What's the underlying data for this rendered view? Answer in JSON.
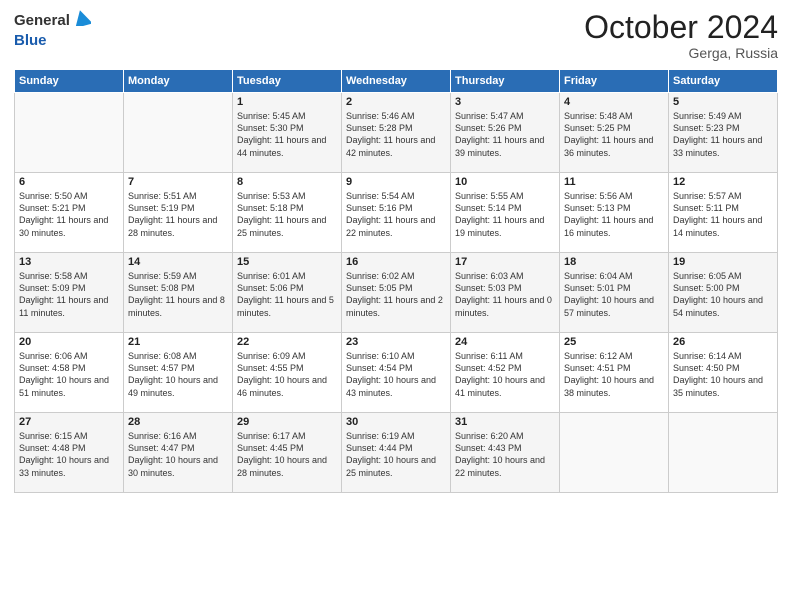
{
  "header": {
    "logo_general": "General",
    "logo_blue": "Blue",
    "month_year": "October 2024",
    "location": "Gerga, Russia"
  },
  "columns": [
    "Sunday",
    "Monday",
    "Tuesday",
    "Wednesday",
    "Thursday",
    "Friday",
    "Saturday"
  ],
  "weeks": [
    [
      {
        "day": "",
        "info": ""
      },
      {
        "day": "",
        "info": ""
      },
      {
        "day": "1",
        "info": "Sunrise: 5:45 AM\nSunset: 5:30 PM\nDaylight: 11 hours and 44 minutes."
      },
      {
        "day": "2",
        "info": "Sunrise: 5:46 AM\nSunset: 5:28 PM\nDaylight: 11 hours and 42 minutes."
      },
      {
        "day": "3",
        "info": "Sunrise: 5:47 AM\nSunset: 5:26 PM\nDaylight: 11 hours and 39 minutes."
      },
      {
        "day": "4",
        "info": "Sunrise: 5:48 AM\nSunset: 5:25 PM\nDaylight: 11 hours and 36 minutes."
      },
      {
        "day": "5",
        "info": "Sunrise: 5:49 AM\nSunset: 5:23 PM\nDaylight: 11 hours and 33 minutes."
      }
    ],
    [
      {
        "day": "6",
        "info": "Sunrise: 5:50 AM\nSunset: 5:21 PM\nDaylight: 11 hours and 30 minutes."
      },
      {
        "day": "7",
        "info": "Sunrise: 5:51 AM\nSunset: 5:19 PM\nDaylight: 11 hours and 28 minutes."
      },
      {
        "day": "8",
        "info": "Sunrise: 5:53 AM\nSunset: 5:18 PM\nDaylight: 11 hours and 25 minutes."
      },
      {
        "day": "9",
        "info": "Sunrise: 5:54 AM\nSunset: 5:16 PM\nDaylight: 11 hours and 22 minutes."
      },
      {
        "day": "10",
        "info": "Sunrise: 5:55 AM\nSunset: 5:14 PM\nDaylight: 11 hours and 19 minutes."
      },
      {
        "day": "11",
        "info": "Sunrise: 5:56 AM\nSunset: 5:13 PM\nDaylight: 11 hours and 16 minutes."
      },
      {
        "day": "12",
        "info": "Sunrise: 5:57 AM\nSunset: 5:11 PM\nDaylight: 11 hours and 14 minutes."
      }
    ],
    [
      {
        "day": "13",
        "info": "Sunrise: 5:58 AM\nSunset: 5:09 PM\nDaylight: 11 hours and 11 minutes."
      },
      {
        "day": "14",
        "info": "Sunrise: 5:59 AM\nSunset: 5:08 PM\nDaylight: 11 hours and 8 minutes."
      },
      {
        "day": "15",
        "info": "Sunrise: 6:01 AM\nSunset: 5:06 PM\nDaylight: 11 hours and 5 minutes."
      },
      {
        "day": "16",
        "info": "Sunrise: 6:02 AM\nSunset: 5:05 PM\nDaylight: 11 hours and 2 minutes."
      },
      {
        "day": "17",
        "info": "Sunrise: 6:03 AM\nSunset: 5:03 PM\nDaylight: 11 hours and 0 minutes."
      },
      {
        "day": "18",
        "info": "Sunrise: 6:04 AM\nSunset: 5:01 PM\nDaylight: 10 hours and 57 minutes."
      },
      {
        "day": "19",
        "info": "Sunrise: 6:05 AM\nSunset: 5:00 PM\nDaylight: 10 hours and 54 minutes."
      }
    ],
    [
      {
        "day": "20",
        "info": "Sunrise: 6:06 AM\nSunset: 4:58 PM\nDaylight: 10 hours and 51 minutes."
      },
      {
        "day": "21",
        "info": "Sunrise: 6:08 AM\nSunset: 4:57 PM\nDaylight: 10 hours and 49 minutes."
      },
      {
        "day": "22",
        "info": "Sunrise: 6:09 AM\nSunset: 4:55 PM\nDaylight: 10 hours and 46 minutes."
      },
      {
        "day": "23",
        "info": "Sunrise: 6:10 AM\nSunset: 4:54 PM\nDaylight: 10 hours and 43 minutes."
      },
      {
        "day": "24",
        "info": "Sunrise: 6:11 AM\nSunset: 4:52 PM\nDaylight: 10 hours and 41 minutes."
      },
      {
        "day": "25",
        "info": "Sunrise: 6:12 AM\nSunset: 4:51 PM\nDaylight: 10 hours and 38 minutes."
      },
      {
        "day": "26",
        "info": "Sunrise: 6:14 AM\nSunset: 4:50 PM\nDaylight: 10 hours and 35 minutes."
      }
    ],
    [
      {
        "day": "27",
        "info": "Sunrise: 6:15 AM\nSunset: 4:48 PM\nDaylight: 10 hours and 33 minutes."
      },
      {
        "day": "28",
        "info": "Sunrise: 6:16 AM\nSunset: 4:47 PM\nDaylight: 10 hours and 30 minutes."
      },
      {
        "day": "29",
        "info": "Sunrise: 6:17 AM\nSunset: 4:45 PM\nDaylight: 10 hours and 28 minutes."
      },
      {
        "day": "30",
        "info": "Sunrise: 6:19 AM\nSunset: 4:44 PM\nDaylight: 10 hours and 25 minutes."
      },
      {
        "day": "31",
        "info": "Sunrise: 6:20 AM\nSunset: 4:43 PM\nDaylight: 10 hours and 22 minutes."
      },
      {
        "day": "",
        "info": ""
      },
      {
        "day": "",
        "info": ""
      }
    ]
  ]
}
